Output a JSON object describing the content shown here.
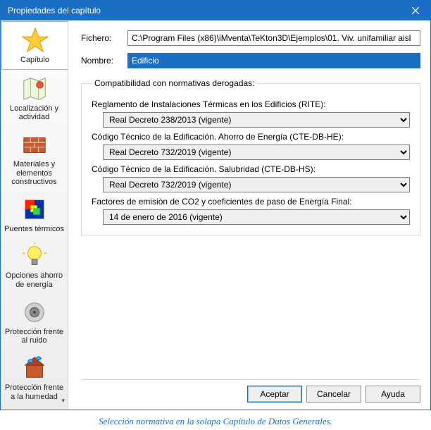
{
  "window": {
    "title": "Propiedades del capítulo"
  },
  "sidebar": {
    "items": [
      {
        "label": "Capítulo"
      },
      {
        "label": "Localización y actividad"
      },
      {
        "label": "Materiales y elementos constructivos"
      },
      {
        "label": "Puentes térmicos"
      },
      {
        "label": "Opciones ahorro de energía"
      },
      {
        "label": "Protección frente al ruido"
      },
      {
        "label": "Protección frente a la humedad"
      }
    ]
  },
  "form": {
    "file_label": "Fichero:",
    "file_value": "C:\\Program Files (x86)\\iMventa\\TeKton3D\\Ejemplos\\01. Viv. unifamiliar aisl",
    "name_label": "Nombre:",
    "name_value": "Edificio"
  },
  "group": {
    "legend": "Compatibilidad con normativas derogadas:",
    "rite_label": "Reglamento de Instalaciones Térmicas en los Edificios (RITE):",
    "rite_value": "Real Decreto 238/2013 (vigente)",
    "cte_he_label": "Código Técnico de la Edificación. Ahorro de Energía (CTE-DB-HE):",
    "cte_he_value": "Real Decreto 732/2019 (vigente)",
    "cte_hs_label": "Código Técnico de la Edificación. Salubridad (CTE-DB-HS):",
    "cte_hs_value": "Real Decreto 732/2019 (vigente)",
    "co2_label": "Factores de emisión de CO2 y coeficientes de paso de Energía Final:",
    "co2_value": "14 de enero de 2016 (vigente)"
  },
  "buttons": {
    "accept": "Aceptar",
    "cancel": "Cancelar",
    "help": "Ayuda"
  },
  "caption": "Selección normativa en la solapa Capítulo de Datos Generales."
}
